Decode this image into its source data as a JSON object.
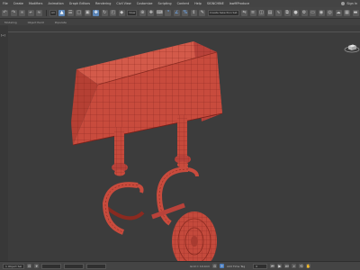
{
  "menubar": {
    "items": [
      "File",
      "Create",
      "Modifiers",
      "Animation",
      "Graph Editors",
      "Rendering",
      "Civil View",
      "Customize",
      "Scripting",
      "Content",
      "Help",
      "SIGNCHINE",
      "lawMProduce"
    ],
    "sign_in": "Sign In"
  },
  "toolbar": {
    "filter_dropdown": "All",
    "view_dropdown": "View",
    "selection_set": "Create Selection Set"
  },
  "ribbon": {
    "tabs": [
      "Modeling",
      "Object Paint",
      "Populate"
    ]
  },
  "viewport": {
    "label": "[+]",
    "model_color": "#c9473a",
    "wire_color": "#7a1f18"
  },
  "statusbar": {
    "objects": "1 Object Sel",
    "grid": "Grid = 10.0cm",
    "add_time_tag": "Add Time Tag",
    "frame": "0"
  }
}
